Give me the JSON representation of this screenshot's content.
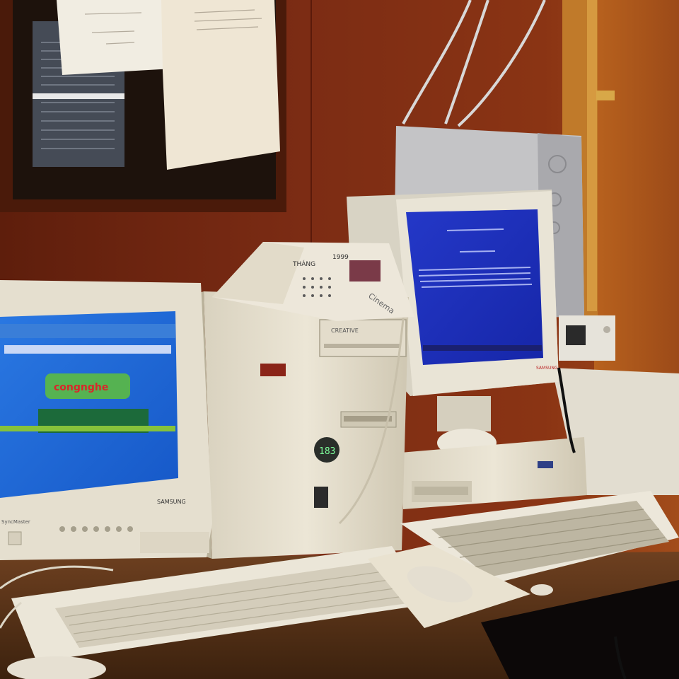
{
  "scene": {
    "type": "photo",
    "text": {
      "calendar_month": "THÁNG",
      "calendar_year": "1999",
      "calendar_brand": "Cinema",
      "left_monitor_brand": "SAMSUNG",
      "left_monitor_model": "SyncMaster",
      "left_screen_logo": "congnghe",
      "tower_drive_brand": "CREATIVE",
      "tower_led_value": "183",
      "right_monitor_brand": "SAMSUNG"
    },
    "colors": {
      "wood_panel": "#7a2a12",
      "wood_light": "#a8501c",
      "cork_board": "#1d120c",
      "beige_case": "#e8e1cf",
      "left_screen": "#1f6ed9",
      "right_screen": "#1c2fbe",
      "desk": "#5a3418",
      "led_green": "#7dff9a"
    }
  }
}
